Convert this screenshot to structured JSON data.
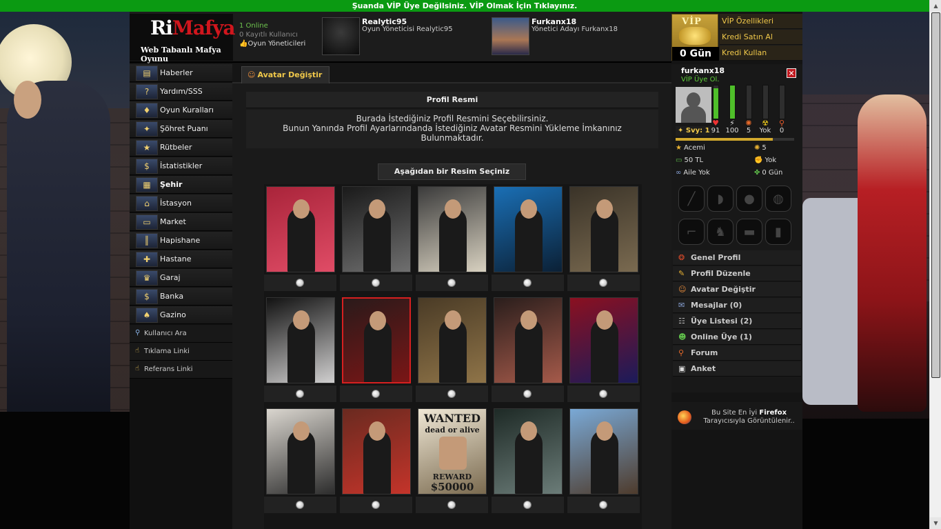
{
  "banner": {
    "text": "Şuanda VİP Üye Değilsiniz. VİP Olmak İçin Tıklayınız."
  },
  "header": {
    "logo_main": "RiMafya",
    "logo_ri": "Ri",
    "logo_mafya": "Mafya",
    "logo_sub": "Web Tabanlı Mafya Oyunu",
    "online": "1 Online",
    "registered": "0 Kayıtlı Kullanıcı",
    "admins": "Oyun Yöneticileri",
    "staff": [
      {
        "name": "Realytic95",
        "role": "Oyun Yöneticisi Realytic95"
      },
      {
        "name": "Furkanx18",
        "role": "Yönetici Adayı Furkanx18"
      }
    ]
  },
  "vip": {
    "badge": "VİP",
    "days": "0 Gün",
    "links": [
      "VİP Özellikleri",
      "Kredi Satın Al",
      "Kredi Kullan"
    ]
  },
  "nav": {
    "items": [
      {
        "label": "Haberler",
        "icon": "newspaper-icon",
        "glyph": "▤"
      },
      {
        "label": "Yardım/SSS",
        "icon": "help-icon",
        "glyph": "?"
      },
      {
        "label": "Oyun Kuralları",
        "icon": "rules-icon",
        "glyph": "♦"
      },
      {
        "label": "Şöhret Puanı",
        "icon": "fame-icon",
        "glyph": "✦"
      },
      {
        "label": "Rütbeler",
        "icon": "rank-icon",
        "glyph": "★"
      },
      {
        "label": "İstatistikler",
        "icon": "stats-icon",
        "glyph": "$"
      },
      {
        "label": "Şehir",
        "icon": "city-icon",
        "glyph": "▦",
        "bold": true
      },
      {
        "label": "İstasyon",
        "icon": "station-icon",
        "glyph": "⌂"
      },
      {
        "label": "Market",
        "icon": "market-icon",
        "glyph": "▭"
      },
      {
        "label": "Hapishane",
        "icon": "prison-icon",
        "glyph": "║"
      },
      {
        "label": "Hastane",
        "icon": "hospital-icon",
        "glyph": "✚"
      },
      {
        "label": "Garaj",
        "icon": "trophy-icon",
        "glyph": "♛"
      },
      {
        "label": "Banka",
        "icon": "bank-icon",
        "glyph": "$"
      },
      {
        "label": "Gazino",
        "icon": "casino-icon",
        "glyph": "♠"
      }
    ],
    "small": [
      {
        "label": "Kullanıcı Ara",
        "glyph": "⚲"
      },
      {
        "label": "Tıklama Linki",
        "glyph": "☝"
      },
      {
        "label": "Referans Linki",
        "glyph": "☝"
      }
    ]
  },
  "content": {
    "tab_label": "Avatar Değiştir",
    "section_title": "Profil Resmi",
    "info_line1": "Burada İstediğiniz Profil Resmini Seçebilirsiniz.",
    "info_line2": "Bunun Yanında Profil Ayarlarındanda İstediğiniz Avatar Resmini Yükleme İmkanınız",
    "info_line3": "Bulunmaktadır.",
    "choose_label": "Aşağıdan bir Resim Seçiniz",
    "wanted_top": "WANTED",
    "wanted_sub": "dead or alive",
    "wanted_reward": "REWARD",
    "wanted_amount": "$50000",
    "avatars": [
      {
        "bg": "#a9243a",
        "accent": "#e04c66"
      },
      {
        "bg": "#1a1a1a",
        "accent": "#6f6f6f"
      },
      {
        "bg": "#3b3b3b",
        "accent": "#d8d1c0"
      },
      {
        "bg": "#1a6fb5",
        "accent": "#0b2035"
      },
      {
        "bg": "#3a3328",
        "accent": "#7a6a50"
      },
      {
        "bg": "#121212",
        "accent": "#d0cfcf"
      },
      {
        "bg": "#2a1a1a",
        "accent": "#7a1616",
        "selected": true
      },
      {
        "bg": "#4a3b26",
        "accent": "#8f7448"
      },
      {
        "bg": "#2a1e1c",
        "accent": "#a55a4a"
      },
      {
        "bg": "#8b1020",
        "accent": "#1b1b5a"
      },
      {
        "bg": "#dad6cf",
        "accent": "#2d2d2d"
      },
      {
        "bg": "#6a2a20",
        "accent": "#c4342a"
      },
      {
        "bg": "#efe7d5",
        "accent": "#7a6a4f",
        "wanted": true
      },
      {
        "bg": "#1e2a26",
        "accent": "#6b7c78"
      },
      {
        "bg": "#7aa9d6",
        "accent": "#4e3b2c"
      }
    ]
  },
  "user": {
    "name": "furkanx18",
    "vip_join": "VİP Üye Ol.",
    "level": "Svy: 1",
    "stats": [
      {
        "icon": "heart-icon",
        "glyph": "♥",
        "color": "#e33",
        "value": "91",
        "fill": 0.91
      },
      {
        "icon": "energy-icon",
        "glyph": "⚡",
        "color": "#ddd",
        "value": "100",
        "fill": 1.0
      },
      {
        "icon": "burst-icon",
        "glyph": "✺",
        "color": "#e86a2a",
        "value": "5",
        "fill": 0.0
      },
      {
        "icon": "hazard-icon",
        "glyph": "☢",
        "color": "#e3c21b",
        "value": "Yok",
        "fill": 0.0
      },
      {
        "icon": "search-icon",
        "glyph": "⚲",
        "color": "#e85a2a",
        "value": "0",
        "fill": 0.0
      }
    ],
    "xp_fill": 0.82,
    "info": {
      "rank": "Acemi",
      "respect": "5",
      "money": "50 TL",
      "gang": "Yok",
      "family": "Aile Yok",
      "days": "0 Gün"
    },
    "menu": [
      {
        "label": "Genel Profil",
        "icon": "profile-icon",
        "glyph": "❂",
        "color": "#d94a2a"
      },
      {
        "label": "Profil Düzenle",
        "icon": "edit-icon",
        "glyph": "✎",
        "color": "#e9b233"
      },
      {
        "label": "Avatar Değiştir",
        "icon": "avatar-icon",
        "glyph": "☺",
        "color": "#e58a3a"
      },
      {
        "label": "Mesajlar (0)",
        "icon": "mail-icon",
        "glyph": "✉",
        "color": "#8aa4d8"
      },
      {
        "label": "Üye Listesi (2)",
        "icon": "members-icon",
        "glyph": "☷",
        "color": "#bbb"
      },
      {
        "label": "Online Üye (1)",
        "icon": "online-icon",
        "glyph": "☻",
        "color": "#5fbf4a"
      },
      {
        "label": "Forum",
        "icon": "forum-icon",
        "glyph": "⚲",
        "color": "#e86a2a"
      },
      {
        "label": "Anket",
        "icon": "poll-icon",
        "glyph": "▣",
        "color": "#ddd"
      }
    ]
  },
  "firefox": {
    "line1": "Bu Site En İyi ",
    "brand": "Firefox",
    "line2": "Tarayıcısıyla Görüntülenir.."
  }
}
